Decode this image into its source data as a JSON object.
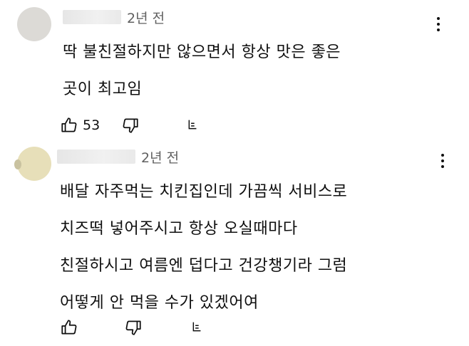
{
  "comments": [
    {
      "time": "2년 전",
      "lines": [
        "딱 불친절하지만 않으면서 항상 맛은 좋은",
        "곳이 최고임"
      ],
      "likes": "53",
      "icons": [
        "thumbs-up-icon",
        "thumbs-down-icon",
        "reply-icon",
        "more-vert-icon"
      ]
    },
    {
      "time": "2년 전",
      "lines": [
        "배달 자주먹는 치킨집인데 가끔씩 서비스로",
        "치즈떡 넣어주시고 항상 오실때마다",
        "친절하시고 여름엔 덥다고 건강챙기라 그럼",
        "어떻게 안 먹을 수가 있겠어여"
      ],
      "likes": "",
      "icons": [
        "thumbs-up-icon",
        "thumbs-down-icon",
        "reply-icon",
        "more-vert-icon"
      ]
    }
  ]
}
